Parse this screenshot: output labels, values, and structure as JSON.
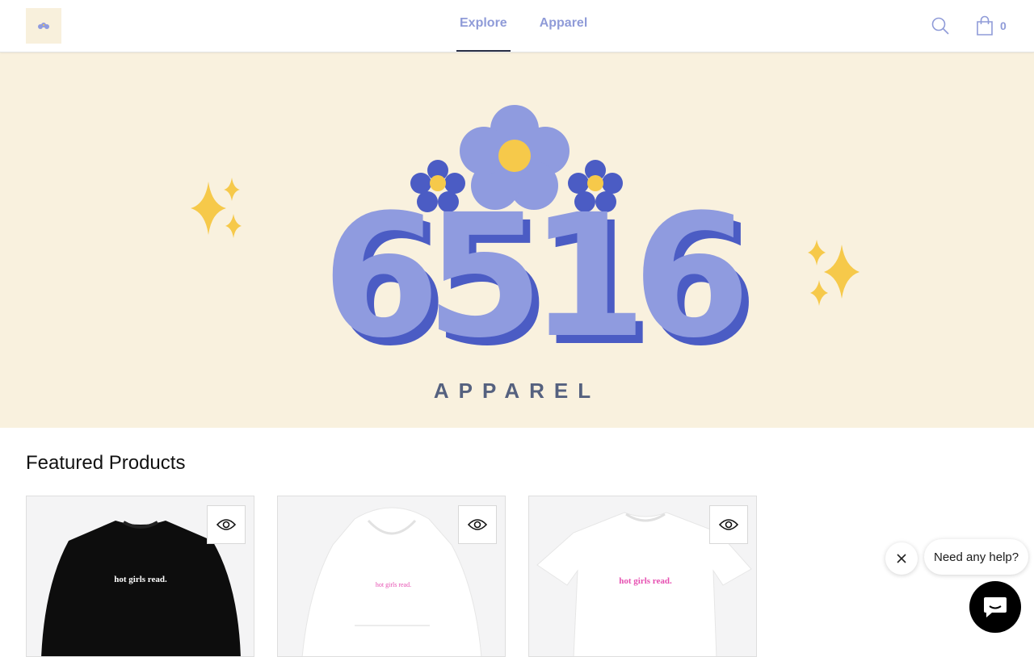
{
  "header": {
    "logo_icon": "flower-logo-icon",
    "nav": [
      {
        "label": "Explore",
        "active": true
      },
      {
        "label": "Apparel",
        "active": false
      }
    ],
    "search_icon": "search-icon",
    "cart_icon": "shopping-bag-icon",
    "cart_count": "0"
  },
  "hero": {
    "brand_number": "6516",
    "brand_word": "APPAREL",
    "colors": {
      "background": "#f9f1de",
      "periwinkle": "#8f9bdf",
      "deep_blue": "#4b5cc4",
      "yellow": "#f6c94a"
    }
  },
  "featured": {
    "title": "Featured Products",
    "products": [
      {
        "print_text": "hot girls read.",
        "garment": "black crewneck sweatshirt",
        "quick_view_icon": "eye-icon"
      },
      {
        "print_text": "hot girls read.",
        "garment": "white hoodie",
        "quick_view_icon": "eye-icon"
      },
      {
        "print_text": "hot girls read.",
        "garment": "white t-shirt",
        "quick_view_icon": "eye-icon"
      }
    ]
  },
  "chat": {
    "prompt": "Need any help?",
    "close_icon": "close-icon",
    "launcher_icon": "chat-icon"
  },
  "colors": {
    "nav_text": "#8f9bd8",
    "pink_print": "#e64fb1"
  }
}
